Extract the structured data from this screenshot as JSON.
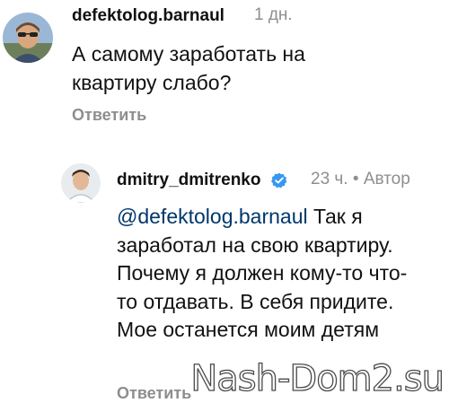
{
  "comments": [
    {
      "username": "defektolog.barnaul",
      "time": "1 дн.",
      "text": "А самому заработать на квартиру слабо?",
      "reply_label": "Ответить"
    },
    {
      "username": "dmitry_dmitrenko",
      "time": "23 ч.",
      "separator": "•",
      "author_label": "Автор",
      "mention": "@defektolog.barnaul",
      "text": "Так я заработал на свою квартиру. Почему я должен кому-то что-то отдавать. В себя придите. Мое останется моим детям",
      "reply_label": "Ответить",
      "verified": true
    }
  ],
  "watermark": "Nash-Dom2.su",
  "colors": {
    "mention": "#00376b",
    "meta": "#8e8e8e",
    "verified": "#3897f0"
  }
}
